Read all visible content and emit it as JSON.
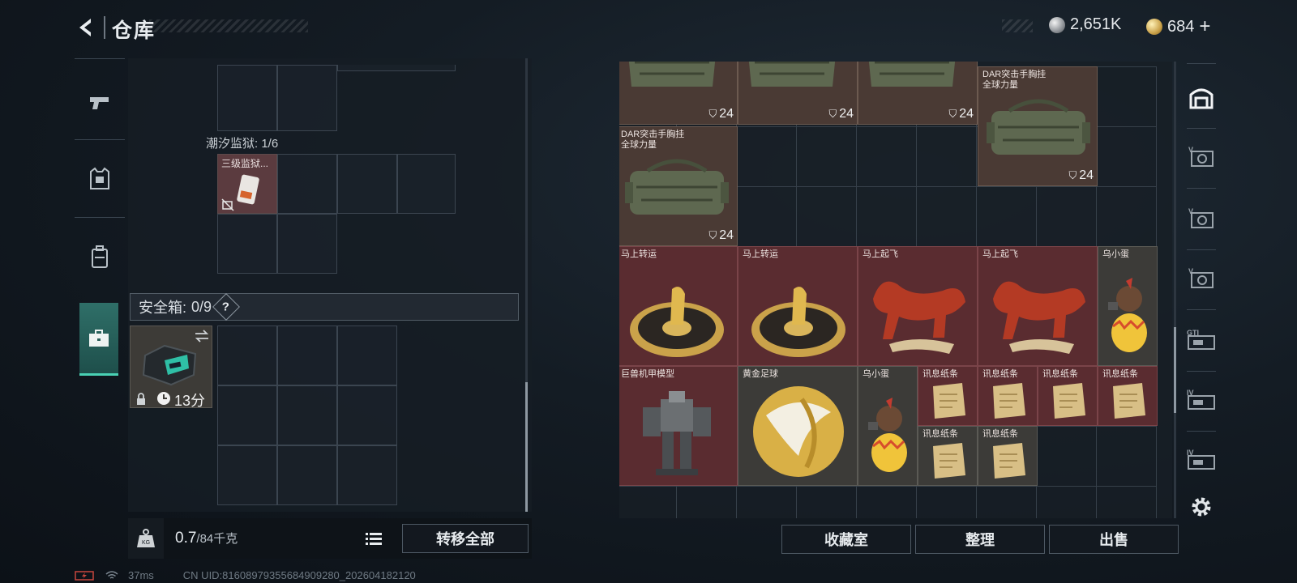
{
  "header": {
    "title": "仓库",
    "currencies": [
      {
        "icon": "silver-coin-icon",
        "value": "2,651K"
      },
      {
        "icon": "gold-coin-icon",
        "value": "684"
      }
    ],
    "add_symbol": "+"
  },
  "left_nav": [
    {
      "icon": "pistol-icon",
      "active": false
    },
    {
      "icon": "body-armor-icon",
      "active": false
    },
    {
      "icon": "backpack-icon",
      "active": false
    },
    {
      "icon": "briefcase-icon",
      "active": true
    }
  ],
  "left_panel": {
    "container_label": "潮汐监狱: 1/6",
    "container_item": {
      "name": "三级监狱...",
      "icon": "keycard-icon",
      "flag_icon": "no-insure-icon"
    },
    "safe_box": {
      "label": "安全箱:",
      "capacity": "0/9",
      "help": "?",
      "timer": "13分",
      "icons": [
        "lock-icon",
        "clock-icon",
        "swap-icon"
      ]
    }
  },
  "left_footer": {
    "weight_icon": "kg-weight-icon",
    "weight_current": "0.7",
    "weight_max": "/84千克",
    "list_icon": "list-icon",
    "transfer_all": "转移全部"
  },
  "right_panel": {
    "items": [
      {
        "name": "",
        "count": "24",
        "type": "bag"
      },
      {
        "name": "",
        "count": "24",
        "type": "bag"
      },
      {
        "name": "",
        "count": "24",
        "type": "bag"
      },
      {
        "name": "DAR突击手胸挂\n全球力量",
        "count": "24",
        "type": "bag"
      },
      {
        "name": "DAR突击手胸挂\n全球力量",
        "count": "24",
        "type": "bag"
      },
      {
        "name": "马上转运",
        "type": "disc"
      },
      {
        "name": "马上转运",
        "type": "disc"
      },
      {
        "name": "马上起飞",
        "type": "horse"
      },
      {
        "name": "马上起飞",
        "type": "horse"
      },
      {
        "name": "乌小蛋",
        "type": "egg"
      },
      {
        "name": "巨兽机甲模型",
        "type": "mech"
      },
      {
        "name": "黄金足球",
        "type": "ball"
      },
      {
        "name": "乌小蛋",
        "type": "egg"
      },
      {
        "name": "讯息纸条",
        "type": "note"
      },
      {
        "name": "讯息纸条",
        "type": "note"
      },
      {
        "name": "讯息纸条",
        "type": "note"
      },
      {
        "name": "讯息纸条",
        "type": "note"
      },
      {
        "name": "讯息纸条",
        "type": "note"
      },
      {
        "name": "讯息纸条",
        "type": "note"
      }
    ],
    "count_icon": "durability-icon"
  },
  "right_footer": {
    "collection": "收藏室",
    "organize": "整理",
    "sell": "出售"
  },
  "right_sidebar": [
    {
      "icon": "home-storage-icon",
      "active": true
    },
    {
      "icon": "v-storage-icon",
      "tag": "V"
    },
    {
      "icon": "v-storage-icon",
      "tag": "V"
    },
    {
      "icon": "v-storage-icon",
      "tag": "V"
    },
    {
      "icon": "gtx-storage-icon",
      "tag": "GTI"
    },
    {
      "icon": "iv-storage-icon",
      "tag": "IV"
    },
    {
      "icon": "iv-storage-icon",
      "tag": "IV"
    },
    {
      "icon": "settings-gear-icon"
    }
  ],
  "status": {
    "battery_icon": "battery-charging-icon",
    "wifi_icon": "wifi-icon",
    "ping": "37ms",
    "uid": "CN UID:8160897935568490928​0_202604182120"
  }
}
